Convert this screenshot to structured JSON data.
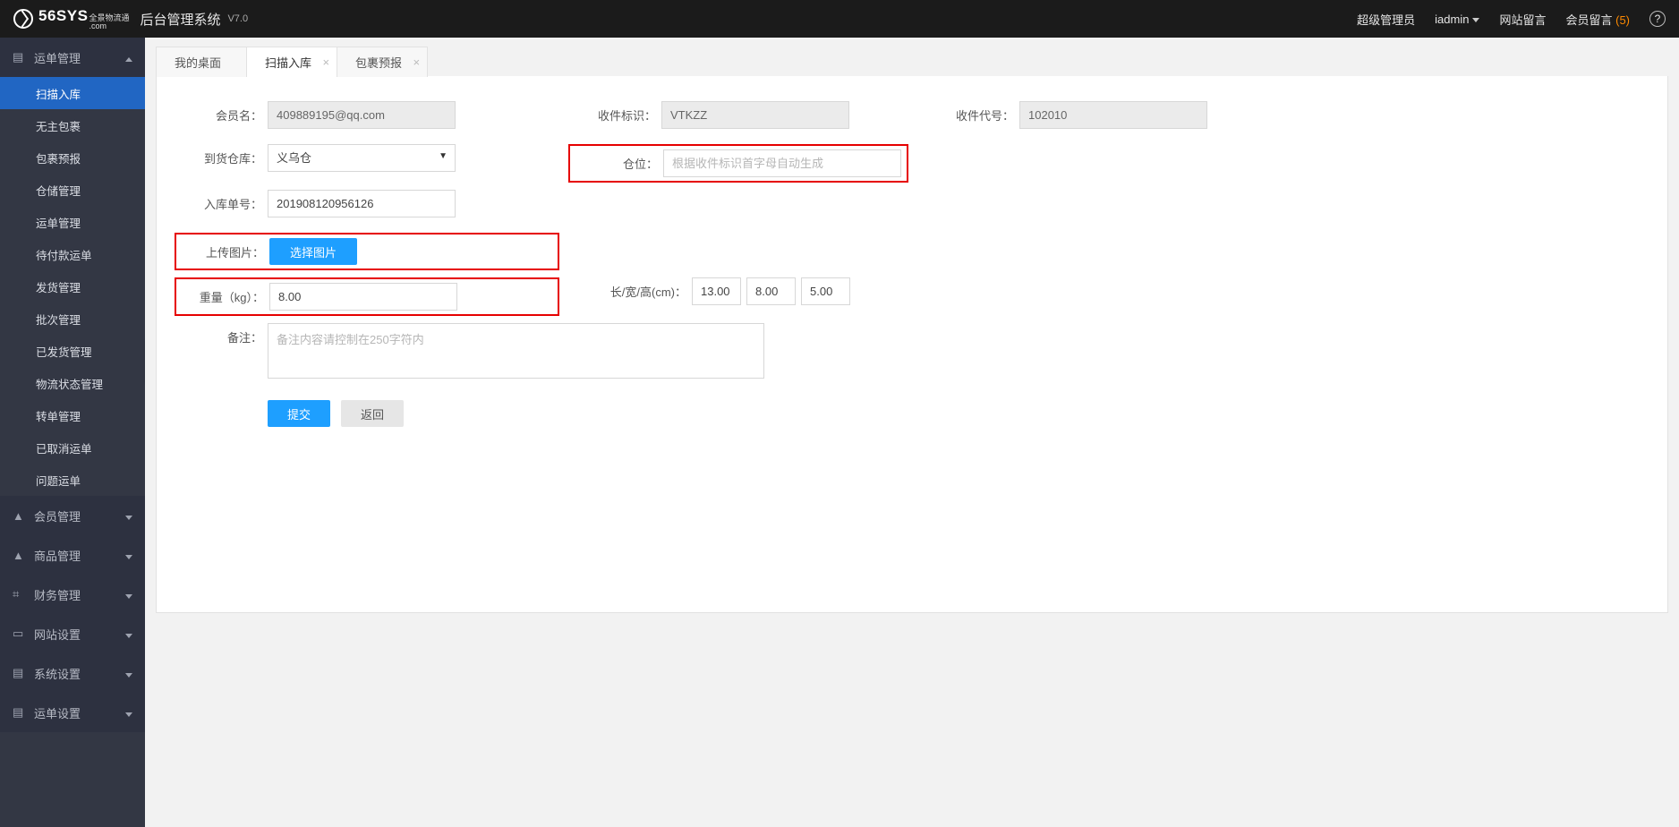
{
  "header": {
    "brand": "56SYS",
    "brand_suffix": ".com",
    "brand_tag": "全景物流通",
    "title": "后台管理系统",
    "version": "V7.0",
    "role": "超级管理员",
    "user": "iadmin",
    "site_msg": "网站留言",
    "member_msg": "会员留言",
    "member_msg_count": "(5)"
  },
  "sidebar": {
    "group_waybill": "运单管理",
    "items": [
      "扫描入库",
      "无主包裹",
      "包裹预报",
      "仓储管理",
      "运单管理",
      "待付款运单",
      "发货管理",
      "批次管理",
      "已发货管理",
      "物流状态管理",
      "转单管理",
      "已取消运单",
      "问题运单"
    ],
    "group_member": "会员管理",
    "group_goods": "商品管理",
    "group_finance": "财务管理",
    "group_site": "网站设置",
    "group_system": "系统设置",
    "group_waybill_cfg": "运单设置"
  },
  "tabs": [
    "我的桌面",
    "扫描入库",
    "包裹预报"
  ],
  "form": {
    "member_lbl": "会员名：",
    "member_val": "409889195@qq.com",
    "recv_tag_lbl": "收件标识：",
    "recv_tag_val": "VTKZZ",
    "recv_code_lbl": "收件代号：",
    "recv_code_val": "102010",
    "warehouse_lbl": "到货仓库：",
    "warehouse_val": "义乌仓",
    "slot_lbl": "仓位：",
    "slot_ph": "根据收件标识首字母自动生成",
    "inbound_lbl": "入库单号：",
    "inbound_val": "201908120956126",
    "upload_lbl": "上传图片：",
    "upload_btn": "选择图片",
    "weight_lbl": "重量（kg）：",
    "weight_val": "8.00",
    "dim_lbl": "长/宽/高(cm)：",
    "dim_l": "13.00",
    "dim_w": "8.00",
    "dim_h": "5.00",
    "remark_lbl": "备注：",
    "remark_ph": "备注内容请控制在250字符内",
    "submit": "提交",
    "back": "返回"
  }
}
